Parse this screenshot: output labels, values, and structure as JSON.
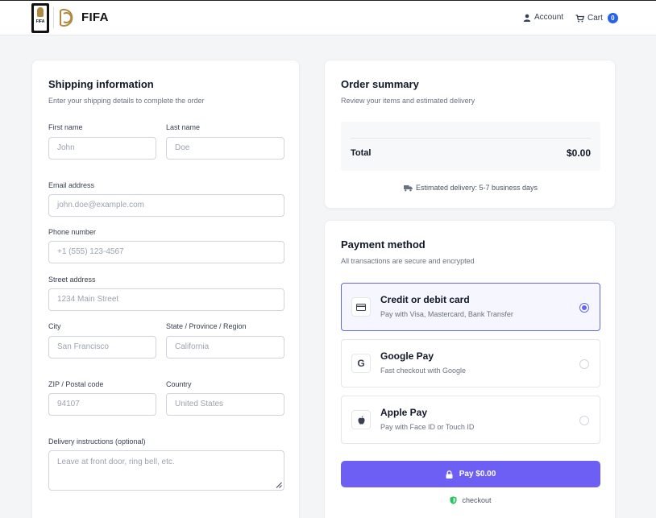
{
  "header": {
    "brand": "FIFA",
    "badge_text": "FIFA",
    "account_label": "Account",
    "cart_label": "Cart",
    "cart_count": "0"
  },
  "shipping": {
    "title": "Shipping information",
    "subtitle": "Enter your shipping details to complete the order",
    "first_name": {
      "label": "First name",
      "placeholder": "John"
    },
    "last_name": {
      "label": "Last name",
      "placeholder": "Doe"
    },
    "email": {
      "label": "Email address",
      "placeholder": "john.doe@example.com"
    },
    "phone": {
      "label": "Phone number",
      "placeholder": "+1 (555) 123-4567"
    },
    "street": {
      "label": "Street address",
      "placeholder": "1234 Main Street"
    },
    "city": {
      "label": "City",
      "placeholder": "San Francisco"
    },
    "state": {
      "label": "State / Province / Region",
      "placeholder": "California"
    },
    "zip": {
      "label": "ZIP / Postal code",
      "placeholder": "94107"
    },
    "country": {
      "label": "Country",
      "placeholder": "United States"
    },
    "instructions": {
      "label": "Delivery instructions (optional)",
      "placeholder": "Leave at front door, ring bell, etc."
    }
  },
  "summary": {
    "title": "Order summary",
    "subtitle": "Review your items and estimated delivery",
    "total_label": "Total",
    "total_value": "$0.00",
    "delivery": "Estimated delivery: 5-7 business days"
  },
  "payment": {
    "title": "Payment method",
    "subtitle": "All transactions are secure and encrypted",
    "methods": [
      {
        "title": "Credit or debit card",
        "desc": "Pay with Visa, Mastercard, Bank Transfer",
        "selected": true,
        "icon": "credit-card-icon"
      },
      {
        "title": "Google Pay",
        "desc": "Fast checkout with Google",
        "selected": false,
        "icon": "google-icon",
        "icon_glyph": "G"
      },
      {
        "title": "Apple Pay",
        "desc": "Pay with Face ID or Touch ID",
        "selected": false,
        "icon": "apple-icon"
      }
    ],
    "pay_label": "Pay $0.00",
    "secure_label": "checkout"
  },
  "colors": {
    "accent": "#6d5ff4",
    "selected_border": "#6366f1",
    "badge": "#2563eb",
    "brand_gold": "#b08a3e"
  }
}
